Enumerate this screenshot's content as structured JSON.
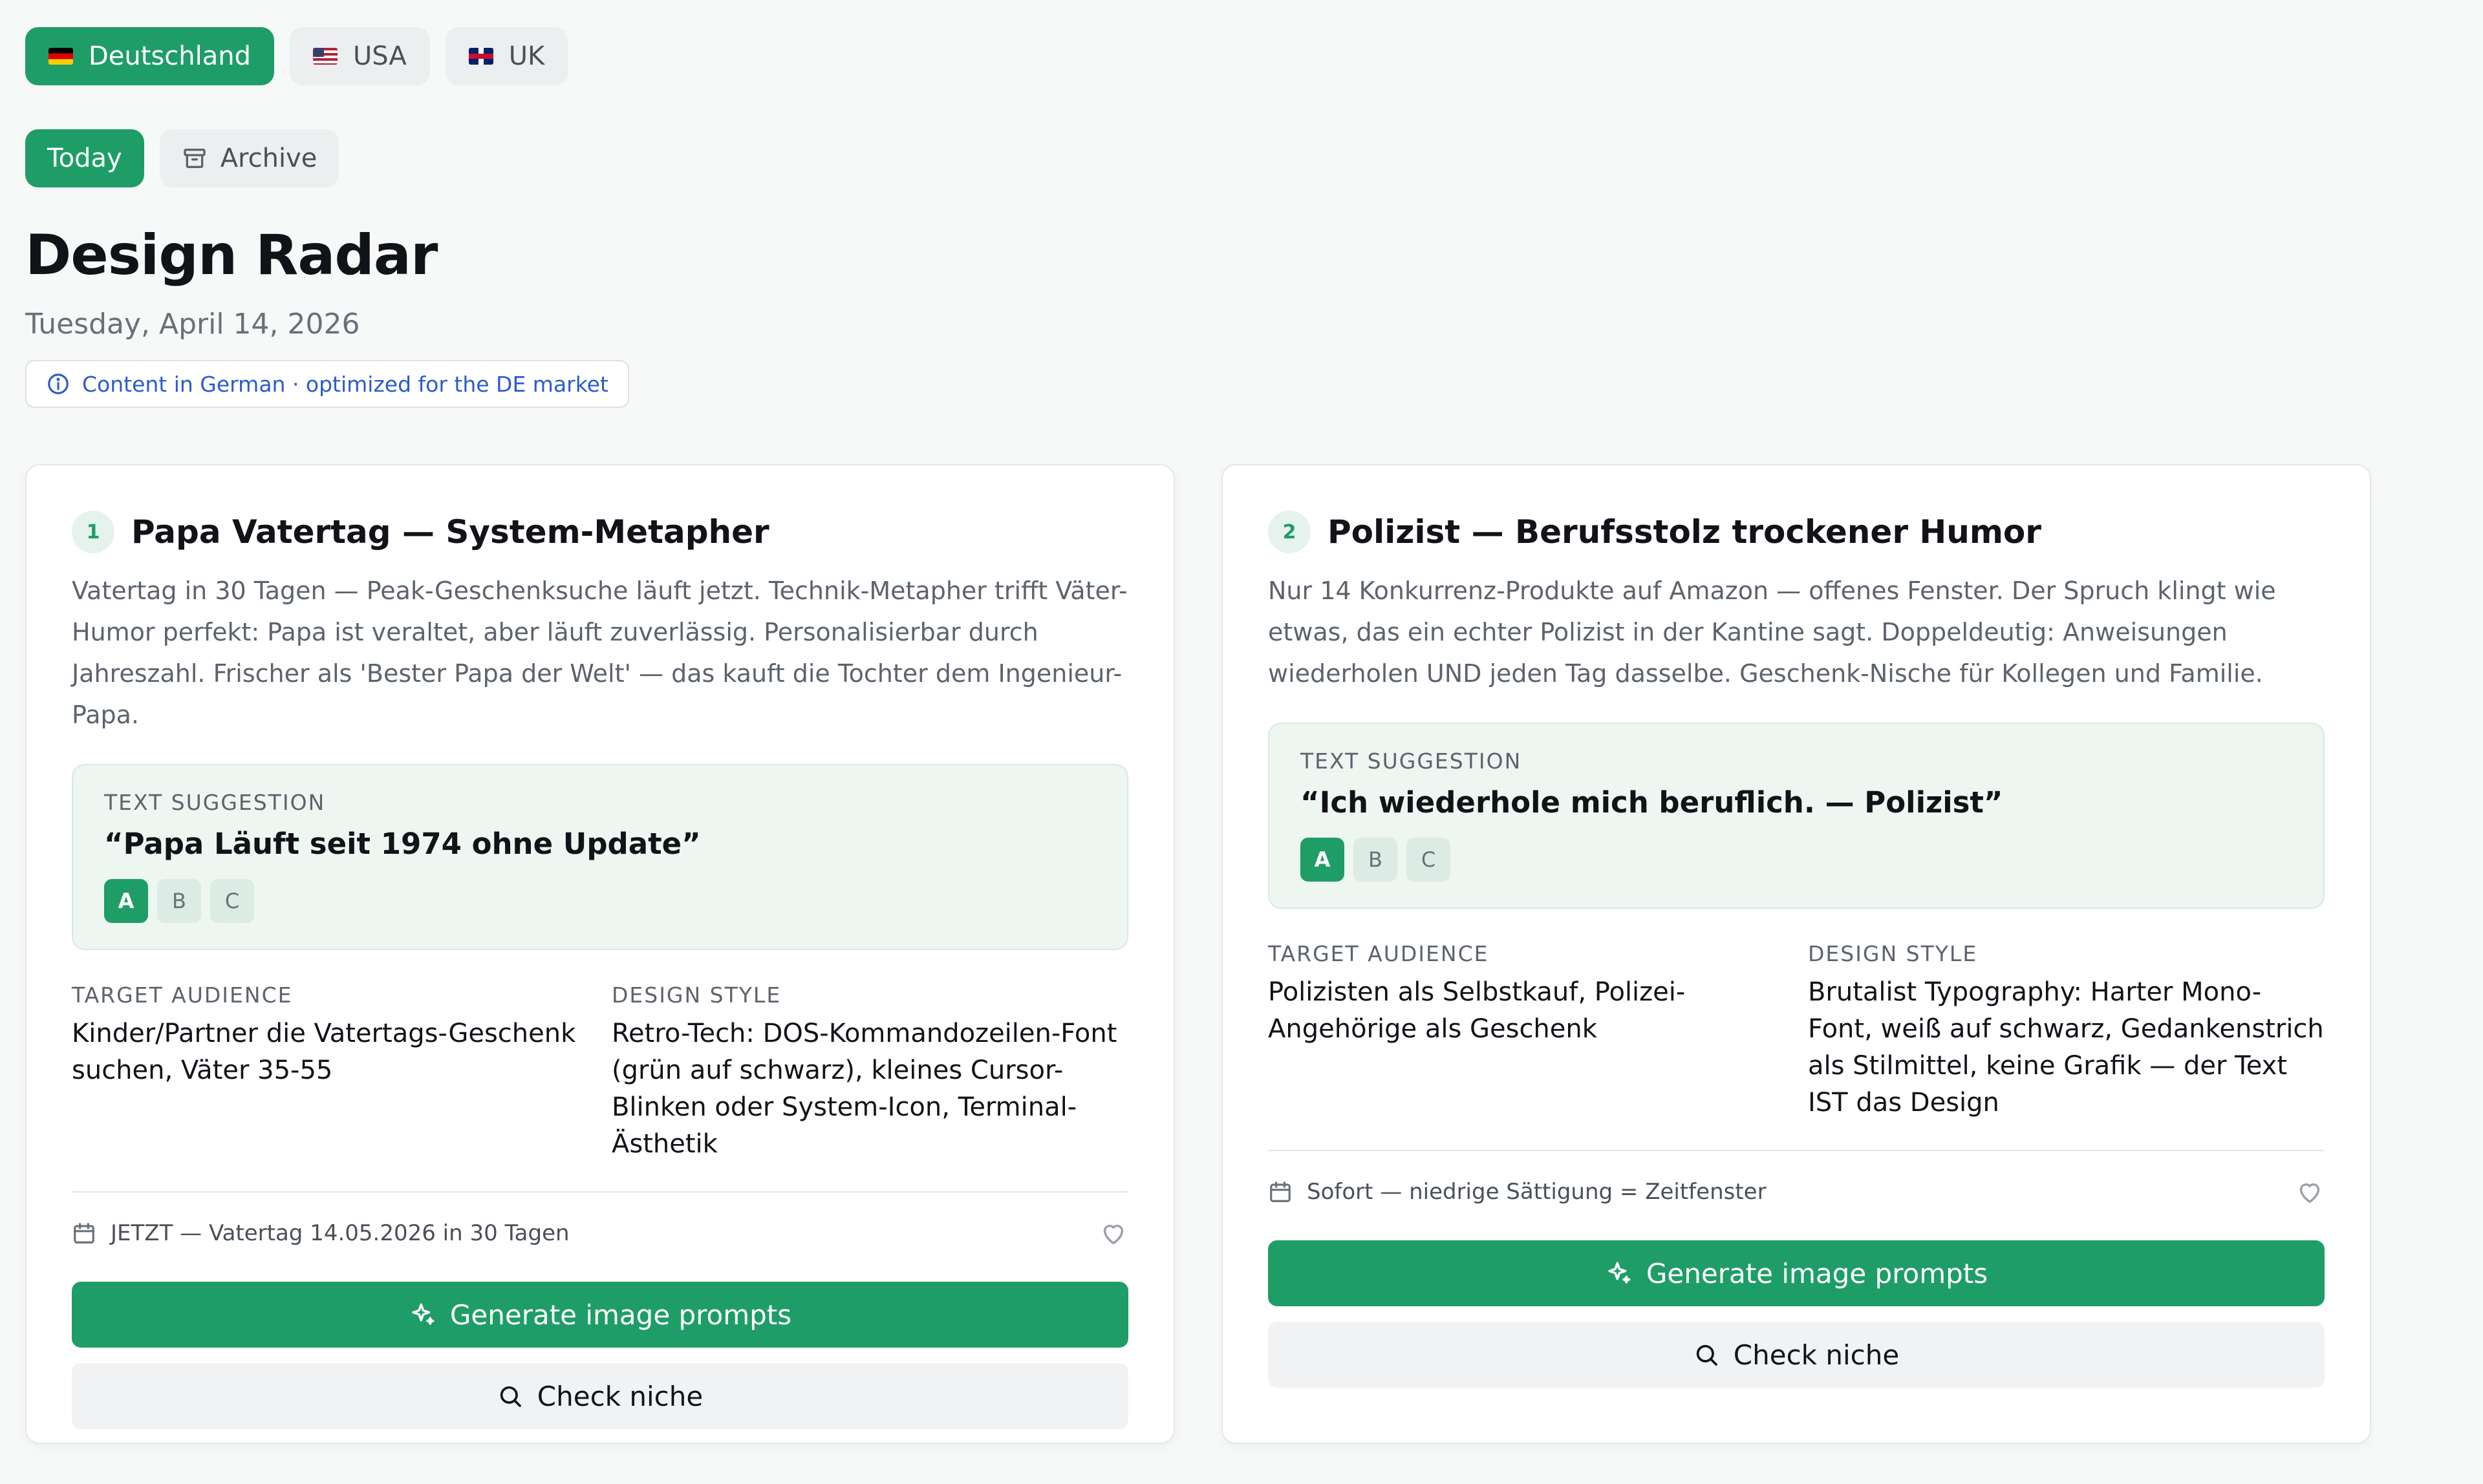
{
  "countries": [
    {
      "label": "Deutschland",
      "flag": "flag-de",
      "active": true
    },
    {
      "label": "USA",
      "flag": "flag-us",
      "active": false
    },
    {
      "label": "UK",
      "flag": "flag-uk",
      "active": false
    }
  ],
  "tabs": {
    "today": "Today",
    "archive": "Archive"
  },
  "header": {
    "title": "Design Radar",
    "date": "Tuesday, April 14, 2026",
    "notice": "Content in German · optimized for the DE market"
  },
  "labels": {
    "text_suggestion": "TEXT SUGGESTION",
    "target_audience": "TARGET AUDIENCE",
    "design_style": "DESIGN STYLE",
    "generate": "Generate image prompts",
    "check": "Check niche"
  },
  "cards": [
    {
      "number": "1",
      "title": "Papa Vatertag — System-Metapher",
      "description": "Vatertag in 30 Tagen — Peak-Geschenksuche läuft jetzt. Technik-Metapher trifft Väter-Humor perfekt: Papa ist veraltet, aber läuft zuverlässig. Personalisierbar durch Jahreszahl. Frischer als 'Bester Papa der Welt' — das kauft die Tochter dem Ingenieur-Papa.",
      "suggestion": "“Papa Läuft seit 1974 ohne Update”",
      "variants": [
        "A",
        "B",
        "C"
      ],
      "audience": "Kinder/Partner die Vatertags-Geschenk suchen, Väter 35-55",
      "style": "Retro-Tech: DOS-Kommandozeilen-Font (grün auf schwarz), kleines Cursor-Blinken oder System-Icon, Terminal-Ästhetik",
      "timing": "JETZT — Vatertag 14.05.2026 in 30 Tagen"
    },
    {
      "number": "2",
      "title": "Polizist — Berufsstolz trockener Humor",
      "description": "Nur 14 Konkurrenz-Produkte auf Amazon — offenes Fenster. Der Spruch klingt wie etwas, das ein echter Polizist in der Kantine sagt. Doppeldeutig: Anweisungen wiederholen UND jeden Tag dasselbe. Geschenk-Nische für Kollegen und Familie.",
      "suggestion": "“Ich wiederhole mich beruflich. — Polizist”",
      "variants": [
        "A",
        "B",
        "C"
      ],
      "audience": "Polizisten als Selbstkauf, Polizei-Angehörige als Geschenk",
      "style": "Brutalist Typography: Harter Mono-Font, weiß auf schwarz, Gedankenstrich als Stilmittel, keine Grafik — der Text IST das Design",
      "timing": "Sofort — niedrige Sättigung = Zeitfenster"
    }
  ],
  "colors": {
    "accent": "#1f9d67",
    "notice_text": "#2b5cc9"
  }
}
